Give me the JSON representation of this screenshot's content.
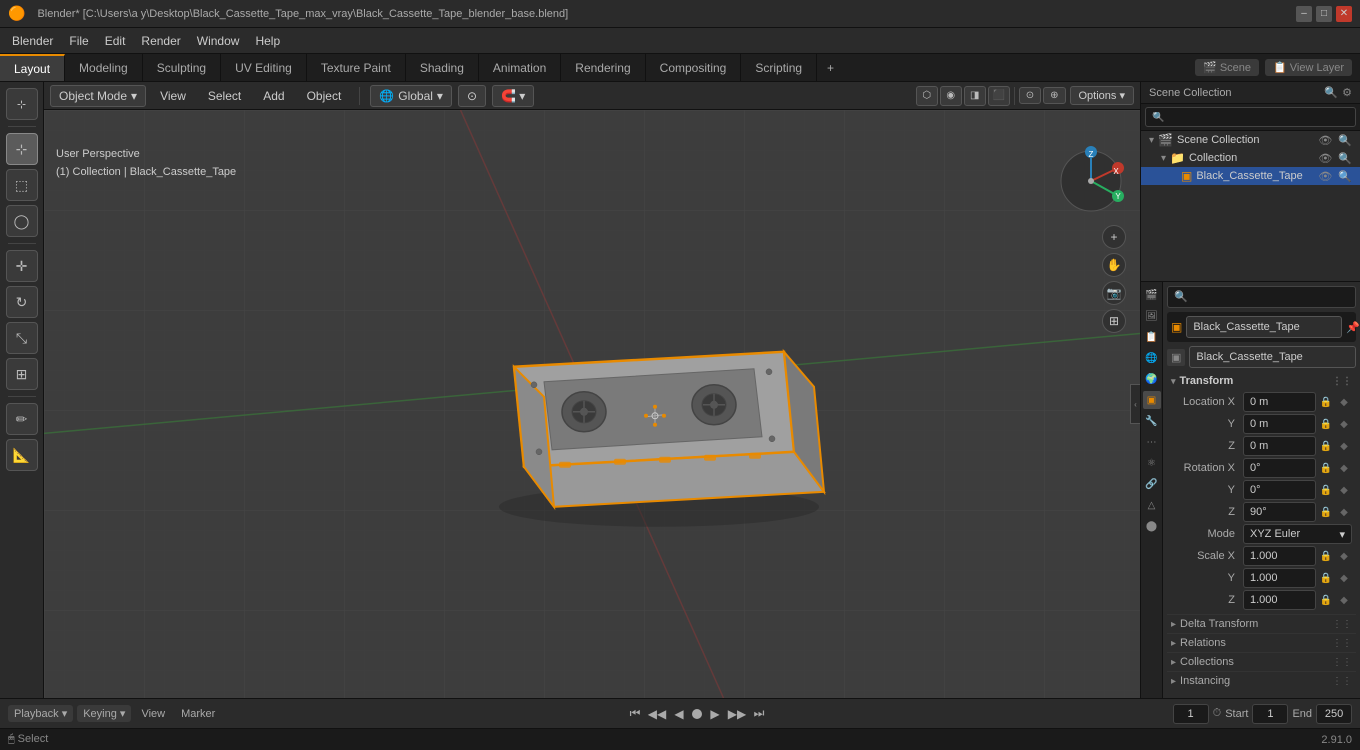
{
  "titleBar": {
    "title": "Blender* [C:\\Users\\a y\\Desktop\\Black_Cassette_Tape_max_vray\\Black_Cassette_Tape_blender_base.blend]",
    "logo": "🟠",
    "winBtns": [
      "–",
      "□",
      "✕"
    ]
  },
  "menuBar": {
    "items": [
      "Blender",
      "File",
      "Edit",
      "Render",
      "Window",
      "Help"
    ]
  },
  "workspaceTabs": {
    "tabs": [
      "Layout",
      "Modeling",
      "Sculpting",
      "UV Editing",
      "Texture Paint",
      "Shading",
      "Animation",
      "Rendering",
      "Compositing",
      "Scripting"
    ],
    "activeTab": "Layout",
    "addLabel": "+",
    "sceneLabel": "Scene",
    "viewLayerLabel": "View Layer"
  },
  "leftToolbar": {
    "tools": [
      {
        "name": "select",
        "icon": "⊹",
        "active": true
      },
      {
        "name": "box-select",
        "icon": "⬚",
        "active": false
      },
      {
        "name": "circle-select",
        "icon": "◯",
        "active": false
      },
      {
        "name": "lasso",
        "icon": "✦",
        "active": false
      },
      {
        "sep": true
      },
      {
        "name": "move",
        "icon": "✛",
        "active": false
      },
      {
        "name": "rotate",
        "icon": "↻",
        "active": false
      },
      {
        "name": "scale",
        "icon": "⤡",
        "active": false
      },
      {
        "name": "transform",
        "icon": "⊞",
        "active": false
      },
      {
        "sep": true
      },
      {
        "name": "annotate",
        "icon": "✏",
        "active": false
      },
      {
        "name": "ruler",
        "icon": "📐",
        "active": false
      }
    ]
  },
  "viewport": {
    "info": {
      "perspective": "User Perspective",
      "collection": "(1) Collection | Black_Cassette_Tape"
    },
    "header": {
      "objectMode": "Object Mode",
      "view": "View",
      "select": "Select",
      "add": "Add",
      "object": "Object",
      "transform": "Global",
      "snap": "⊙",
      "options": "Options ▾"
    },
    "shadingBtns": [
      "⬛",
      "⬡",
      "◉",
      "◨"
    ]
  },
  "outliner": {
    "title": "Scene Collection",
    "items": [
      {
        "name": "Collection",
        "icon": "📁",
        "depth": 0,
        "expanded": true,
        "eyeIcon": "👁",
        "filterIcon": "🔍"
      },
      {
        "name": "Black_Cassette_Tape",
        "icon": "🔶",
        "depth": 1,
        "selected": true,
        "eyeIcon": "👁",
        "filterIcon": "🔍"
      }
    ]
  },
  "propertiesPanel": {
    "objectName": "Black_Cassette_Tape",
    "objectIcon": "▣",
    "pinIcon": "📌",
    "linkedDatablock": "Black_Cassette_Tape",
    "sections": {
      "transform": {
        "label": "Transform",
        "location": {
          "x": "0 m",
          "y": "0 m",
          "z": "0 m"
        },
        "rotation": {
          "x": "0°",
          "y": "0°",
          "z": "90°"
        },
        "rotationMode": "XYZ Euler",
        "scale": {
          "x": "1.000",
          "y": "1.000",
          "z": "1.000"
        }
      },
      "deltaTransform": {
        "label": "Delta Transform"
      },
      "relations": {
        "label": "Relations"
      },
      "collections": {
        "label": "Collections"
      },
      "instancing": {
        "label": "Instancing"
      }
    }
  },
  "bottomBar": {
    "playback": "Playback",
    "keying": "Keying",
    "view": "View",
    "marker": "Marker",
    "currentFrame": "1",
    "startFrame": "1",
    "endFrame": "250",
    "startLabel": "Start",
    "endLabel": "End",
    "playBtns": [
      "⏮",
      "◀◀",
      "◀",
      "▶",
      "▶▶",
      "⏭"
    ]
  },
  "statusBar": {
    "selectLabel": "Select",
    "mouseIcon": "🖱",
    "version": "2.91.0",
    "icons": [
      "⌨",
      "🖱"
    ]
  },
  "colors": {
    "accent": "#e88a00",
    "selected": "#2a5298",
    "bg": "#2b2b2b",
    "bgDark": "#1e1e1e",
    "bgDarker": "#1a1a1a",
    "border": "#111",
    "orange": "#e88a00"
  }
}
